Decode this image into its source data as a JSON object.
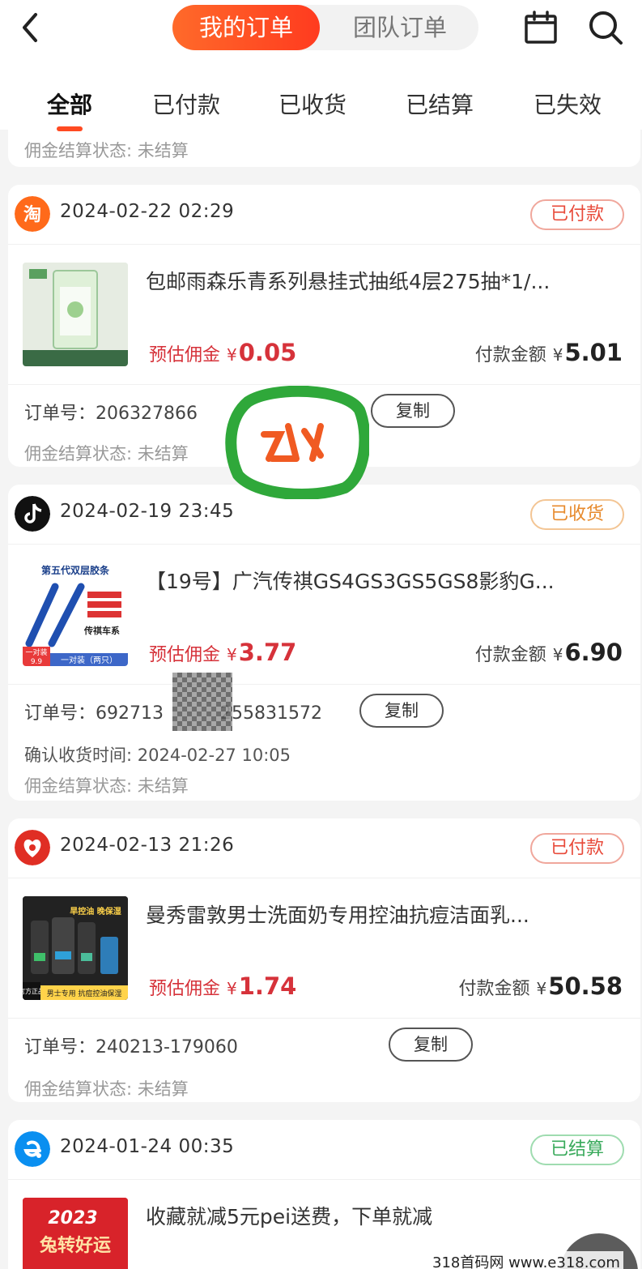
{
  "header": {
    "seg_active": "我的订单",
    "seg_inactive": "团队订单",
    "icons": {
      "back": "back-arrow-icon",
      "calendar": "calendar-icon",
      "search": "search-icon"
    },
    "accent": "#ff4a22"
  },
  "tabs": [
    "全部",
    "已付款",
    "已收货",
    "已结算",
    "已失效"
  ],
  "partial_card": {
    "status_line": "佣金结算状态: 未结算"
  },
  "orders": [
    {
      "platform_icon": "taobao-icon",
      "datetime": "2024-02-22 02:29",
      "status": "已付款",
      "title": "包邮雨森乐青系列悬挂式抽纸4层275抽*1/...",
      "est_label": "预估佣金",
      "currency": "¥",
      "est_amount": "0.05",
      "pay_label": "付款金额",
      "pay_amount": "5.01",
      "order_label": "订单号：",
      "order_no": "206327866",
      "copy": "复制",
      "settle": "佣金结算状态: 未结算"
    },
    {
      "platform_icon": "douyin-icon",
      "datetime": "2024-02-19 23:45",
      "status": "已收货",
      "title": "【19号】广汽传祺GS4GS3GS5GS8影豹G...",
      "thumb_text": [
        "第五代双层胶条",
        "传祺车系",
        "一对装",
        "9.9",
        "一对装（两只）"
      ],
      "est_label": "预估佣金",
      "currency": "¥",
      "est_amount": "3.77",
      "pay_label": "付款金额",
      "pay_amount": "6.90",
      "order_label": "订单号：",
      "order_no_a": "692713",
      "order_no_b": "255831572",
      "copy": "复制",
      "confirm": "确认收货时间: 2024-02-27 10:05",
      "settle": "佣金结算状态: 未结算"
    },
    {
      "platform_icon": "pinduoduo-icon",
      "datetime": "2024-02-13 21:26",
      "status": "已付款",
      "title": "曼秀雷敦男士洗面奶专用控油抗痘洁面乳...",
      "thumb_text": [
        "旱控油 晚保湿",
        "官方正品",
        "男士专用 抗痘控油保湿"
      ],
      "est_label": "预估佣金",
      "currency": "¥",
      "est_amount": "1.74",
      "pay_label": "付款金额",
      "pay_amount": "50.58",
      "order_label": "订单号：",
      "order_no": "240213-179060",
      "copy": "复制",
      "settle": "佣金结算状态: 未结算"
    },
    {
      "platform_icon": "eleme-icon",
      "datetime": "2024-01-24 00:35",
      "status": "已结算",
      "title": "收藏就减5元pei送费，下单就减",
      "thumb_text": [
        "2023",
        "兔转好运"
      ]
    }
  ],
  "watermark": "318首码网  www.e318.com"
}
